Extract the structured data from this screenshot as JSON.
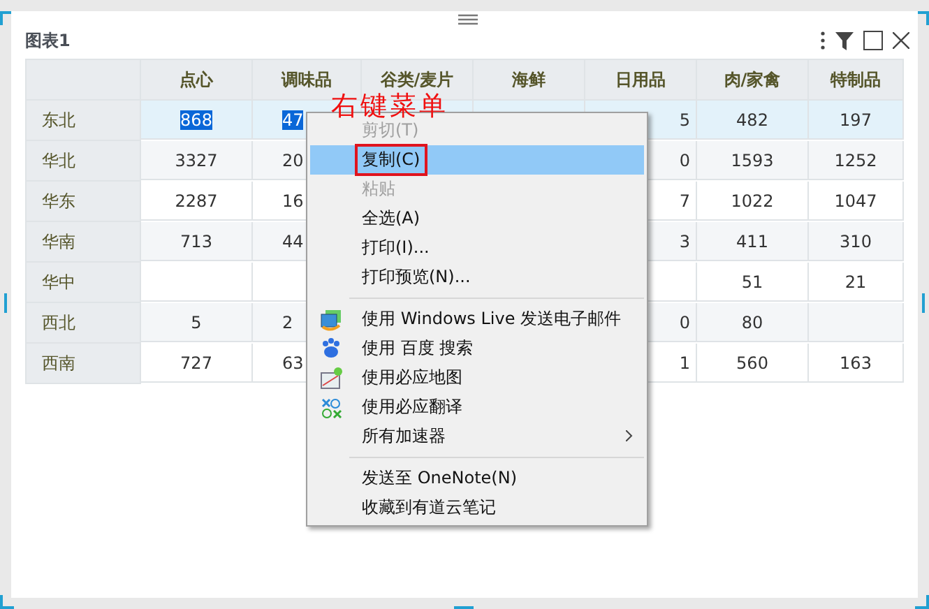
{
  "panel": {
    "title": "图表1"
  },
  "table": {
    "columns": [
      "点心",
      "调味品",
      "谷类/麦片",
      "海鲜",
      "日用品",
      "肉/家禽",
      "特制品"
    ],
    "rows": [
      {
        "label": "东北",
        "hovered": true,
        "cells": [
          {
            "text": "868",
            "selected": true
          },
          {
            "text": "47",
            "selected": true
          },
          null,
          null,
          {
            "text": "5",
            "selected": false
          },
          {
            "text": "482",
            "selected": false
          },
          {
            "text": "197",
            "selected": false
          }
        ]
      },
      {
        "label": "华北",
        "hovered": false,
        "cells": [
          {
            "text": "3327",
            "selected": false
          },
          {
            "text": "20",
            "selected": false
          },
          null,
          null,
          {
            "text": "0",
            "selected": false
          },
          {
            "text": "1593",
            "selected": false
          },
          {
            "text": "1252",
            "selected": false
          }
        ]
      },
      {
        "label": "华东",
        "hovered": false,
        "cells": [
          {
            "text": "2287",
            "selected": false
          },
          {
            "text": "16",
            "selected": false
          },
          null,
          null,
          {
            "text": "7",
            "selected": false
          },
          {
            "text": "1022",
            "selected": false
          },
          {
            "text": "1047",
            "selected": false
          }
        ]
      },
      {
        "label": "华南",
        "hovered": false,
        "cells": [
          {
            "text": "713",
            "selected": false
          },
          {
            "text": "44",
            "selected": false
          },
          null,
          null,
          {
            "text": "3",
            "selected": false
          },
          {
            "text": "411",
            "selected": false
          },
          {
            "text": "310",
            "selected": false
          }
        ]
      },
      {
        "label": "华中",
        "hovered": false,
        "cells": [
          null,
          null,
          null,
          null,
          null,
          {
            "text": "51",
            "selected": false
          },
          {
            "text": "21",
            "selected": false
          }
        ]
      },
      {
        "label": "西北",
        "hovered": false,
        "cells": [
          {
            "text": "5",
            "selected": false
          },
          {
            "text": "2",
            "selected": false
          },
          null,
          null,
          {
            "text": "0",
            "selected": false
          },
          {
            "text": "80",
            "selected": false
          },
          null
        ]
      },
      {
        "label": "西南",
        "hovered": false,
        "cells": [
          {
            "text": "727",
            "selected": false
          },
          {
            "text": "63",
            "selected": false
          },
          null,
          null,
          {
            "text": "1",
            "selected": false
          },
          {
            "text": "560",
            "selected": false
          },
          {
            "text": "163",
            "selected": false
          }
        ]
      }
    ]
  },
  "annotation": {
    "text": "右键菜单"
  },
  "context_menu": {
    "groups": [
      [
        {
          "label": "剪切(T)",
          "kind": "plain",
          "disabled": true,
          "selected": false,
          "boxed": false
        },
        {
          "label": "复制(C)",
          "kind": "plain",
          "disabled": false,
          "selected": true,
          "boxed": true
        },
        {
          "label": "粘贴",
          "kind": "plain",
          "disabled": true,
          "selected": false,
          "boxed": false
        },
        {
          "label": "全选(A)",
          "kind": "plain",
          "disabled": false,
          "selected": false,
          "boxed": false
        },
        {
          "label": "打印(I)...",
          "kind": "plain",
          "disabled": false,
          "selected": false,
          "boxed": false
        },
        {
          "label": "打印预览(N)...",
          "kind": "plain",
          "disabled": false,
          "selected": false,
          "boxed": false
        }
      ],
      [
        {
          "label": "使用 Windows Live 发送电子邮件",
          "kind": "mail",
          "disabled": false,
          "selected": false,
          "boxed": false
        },
        {
          "label": "使用 百度 搜索",
          "kind": "search",
          "disabled": false,
          "selected": false,
          "boxed": false
        },
        {
          "label": "使用必应地图",
          "kind": "map",
          "disabled": false,
          "selected": false,
          "boxed": false
        },
        {
          "label": "使用必应翻译",
          "kind": "translate",
          "disabled": false,
          "selected": false,
          "boxed": false
        },
        {
          "label": "所有加速器",
          "kind": "submenu",
          "disabled": false,
          "selected": false,
          "boxed": false
        }
      ],
      [
        {
          "label": "发送至 OneNote(N)",
          "kind": "plain",
          "disabled": false,
          "selected": false,
          "boxed": false
        },
        {
          "label": "收藏到有道云笔记",
          "kind": "plain",
          "disabled": false,
          "selected": false,
          "boxed": false
        }
      ]
    ]
  }
}
